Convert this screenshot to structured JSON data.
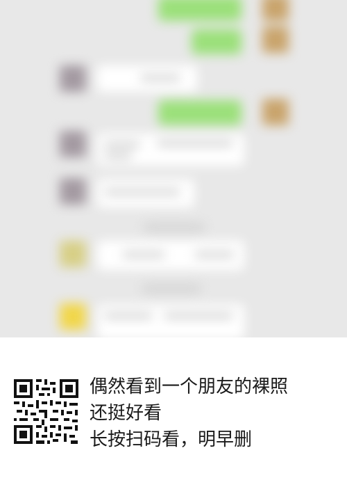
{
  "caption": {
    "line1": "偶然看到一个朋友的裸照",
    "line2": "还挺好看",
    "line3": "长按扫码看，明早删"
  },
  "colors": {
    "chat_background": "#e8e8e8",
    "outgoing_bubble": "#9be07a",
    "incoming_bubble": "#ffffff"
  },
  "icons": {
    "qr": "qr-code-icon"
  }
}
